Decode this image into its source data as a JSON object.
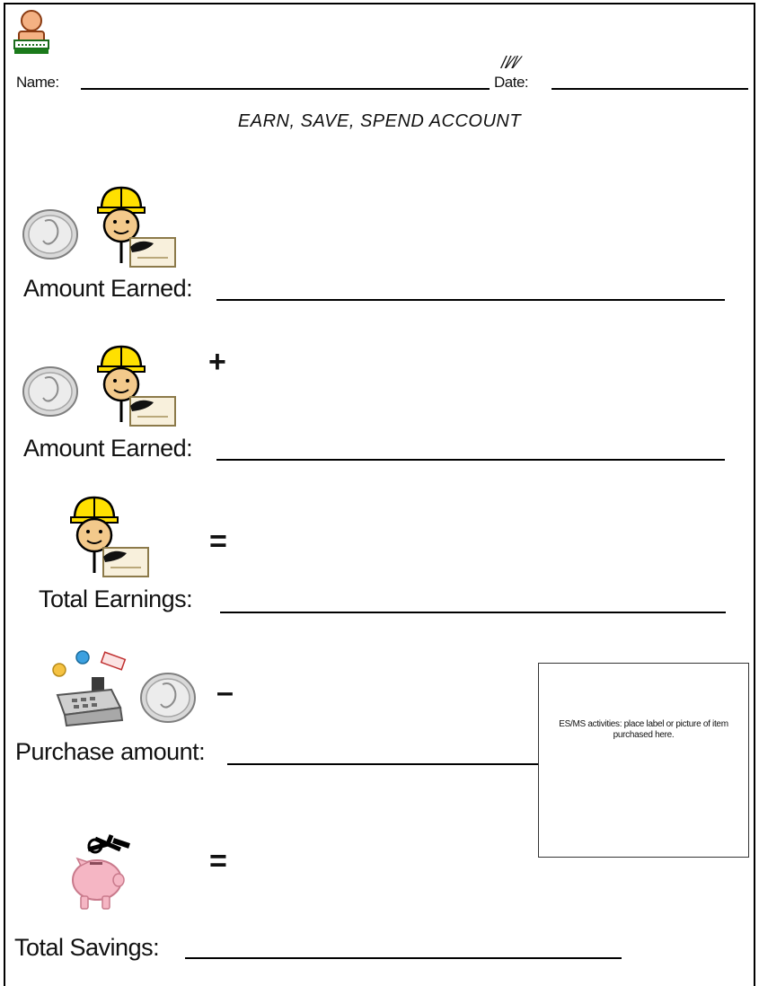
{
  "header": {
    "name_label": "Name:",
    "date_label": "Date:",
    "calendar_glyph": "//⁄/⁄"
  },
  "title": "EARN, SAVE,  SPEND ACCOUNT",
  "rows": {
    "earned_1": {
      "label": "Amount Earned:"
    },
    "earned_2": {
      "label": "Amount Earned:",
      "operator": "+"
    },
    "total_earnings": {
      "label": "Total Earnings:",
      "operator": "="
    },
    "purchase": {
      "label": "Purchase amount:",
      "operator": "–"
    },
    "total_savings": {
      "label": "Total Savings:",
      "operator": "="
    }
  },
  "purchase_box": {
    "text": "ES/MS activities: place label or picture of item purchased here."
  },
  "icons": [
    "person-at-computer-icon",
    "coin-icon",
    "worker-paycheck-icon",
    "cash-register-icon",
    "piggy-bank-icon"
  ]
}
